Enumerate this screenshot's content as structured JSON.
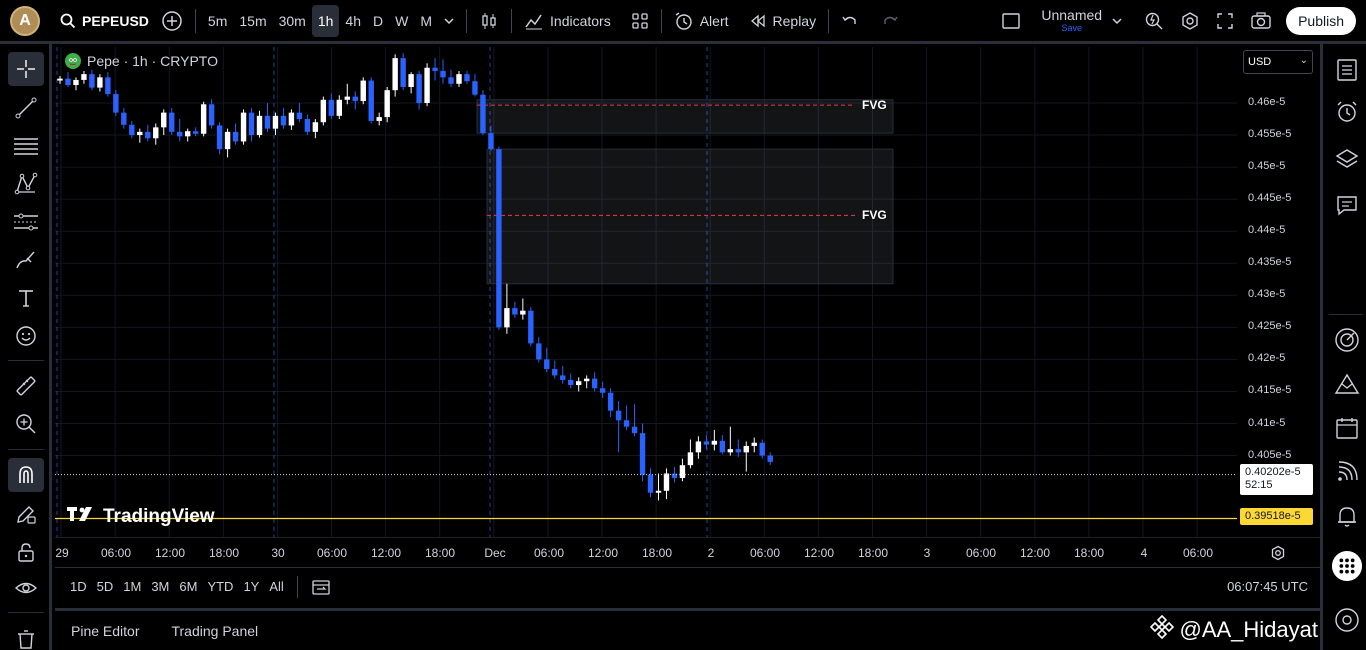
{
  "topbar": {
    "avatar_letter": "A",
    "symbol": "PEPEUSD",
    "timeframes": [
      "5m",
      "15m",
      "30m",
      "1h",
      "4h",
      "D",
      "W",
      "M"
    ],
    "active_timeframe": "1h",
    "indicators_label": "Indicators",
    "alert_label": "Alert",
    "replay_label": "Replay",
    "layout_name": "Unnamed",
    "layout_save": "Save",
    "publish_label": "Publish"
  },
  "legend": {
    "title": "Pepe · 1h · CRYPTO"
  },
  "fvg": [
    {
      "label": "FVG",
      "top": 0.4605,
      "bottom": 0.4553,
      "mid": 0.45967
    },
    {
      "label": "FVG",
      "top": 0.4528,
      "bottom": 0.4318,
      "mid": 0.44247
    }
  ],
  "watermark": "TradingView",
  "price_scale": {
    "currency": "USD",
    "ticks": [
      "0.46e-5",
      "0.455e-5",
      "0.45e-5",
      "0.445e-5",
      "0.44e-5",
      "0.435e-5",
      "0.43e-5",
      "0.425e-5",
      "0.42e-5",
      "0.415e-5",
      "0.41e-5",
      "0.405e-5"
    ],
    "last_price": "0.40202e-5",
    "countdown": "52:15",
    "yellow_price": "0.39518e-5"
  },
  "time_axis": [
    "29",
    "06:00",
    "12:00",
    "18:00",
    "30",
    "06:00",
    "12:00",
    "18:00",
    "Dec",
    "06:00",
    "12:00",
    "18:00",
    "2",
    "06:00",
    "12:00",
    "18:00",
    "3",
    "06:00",
    "12:00",
    "18:00",
    "4",
    "06:00"
  ],
  "range_bar": {
    "ranges": [
      "1D",
      "5D",
      "1M",
      "3M",
      "6M",
      "YTD",
      "1Y",
      "All"
    ],
    "clock": "06:07:45 UTC"
  },
  "bottom_tabs": [
    "Pine Editor",
    "Trading Panel"
  ],
  "handle": "@AA_Hidayat",
  "colors": {
    "up": "#ffffff",
    "down": "#2962ff",
    "fvg_line": "#f23645",
    "yellow": "#fdd835"
  },
  "chart_data": {
    "type": "candlestick",
    "symbol": "PEPEUSD",
    "interval": "1h",
    "price_unit": "e-5 USD",
    "ylim": [
      0.3957,
      0.4678
    ],
    "x_range": [
      "Nov 29 00:00",
      "Dec 4 06:00"
    ],
    "candles": [
      [
        0.4635,
        0.4642,
        0.463,
        0.4638
      ],
      [
        0.4638,
        0.4648,
        0.4625,
        0.4628
      ],
      [
        0.4628,
        0.464,
        0.462,
        0.4636
      ],
      [
        0.4636,
        0.465,
        0.463,
        0.4645
      ],
      [
        0.4645,
        0.4652,
        0.462,
        0.4624
      ],
      [
        0.4624,
        0.4645,
        0.4618,
        0.464
      ],
      [
        0.464,
        0.4648,
        0.461,
        0.4614
      ],
      [
        0.4614,
        0.462,
        0.458,
        0.4585
      ],
      [
        0.4585,
        0.4592,
        0.456,
        0.4566
      ],
      [
        0.4566,
        0.4572,
        0.4545,
        0.455
      ],
      [
        0.455,
        0.456,
        0.4538,
        0.4555
      ],
      [
        0.4555,
        0.4566,
        0.454,
        0.4545
      ],
      [
        0.4545,
        0.4568,
        0.4535,
        0.4562
      ],
      [
        0.4562,
        0.459,
        0.455,
        0.4585
      ],
      [
        0.4585,
        0.4592,
        0.455,
        0.4555
      ],
      [
        0.4555,
        0.4575,
        0.454,
        0.4548
      ],
      [
        0.4548,
        0.456,
        0.454,
        0.4556
      ],
      [
        0.4556,
        0.4562,
        0.4548,
        0.4552
      ],
      [
        0.4552,
        0.4602,
        0.4548,
        0.4598
      ],
      [
        0.4598,
        0.4606,
        0.456,
        0.4565
      ],
      [
        0.4565,
        0.457,
        0.452,
        0.4528
      ],
      [
        0.4528,
        0.456,
        0.4515,
        0.4555
      ],
      [
        0.4555,
        0.4568,
        0.4535,
        0.454
      ],
      [
        0.454,
        0.459,
        0.4535,
        0.4585
      ],
      [
        0.4585,
        0.4592,
        0.454,
        0.455
      ],
      [
        0.455,
        0.4588,
        0.4546,
        0.458
      ],
      [
        0.458,
        0.46,
        0.4555,
        0.456
      ],
      [
        0.456,
        0.4585,
        0.455,
        0.458
      ],
      [
        0.458,
        0.4592,
        0.456,
        0.4565
      ],
      [
        0.4565,
        0.459,
        0.4558,
        0.4585
      ],
      [
        0.4585,
        0.46,
        0.457,
        0.4575
      ],
      [
        0.4575,
        0.4582,
        0.455,
        0.4555
      ],
      [
        0.4555,
        0.4575,
        0.4545,
        0.457
      ],
      [
        0.457,
        0.461,
        0.4565,
        0.4605
      ],
      [
        0.4605,
        0.4615,
        0.4575,
        0.458
      ],
      [
        0.458,
        0.4612,
        0.4575,
        0.4605
      ],
      [
        0.4605,
        0.463,
        0.4598,
        0.461
      ],
      [
        0.461,
        0.4618,
        0.459,
        0.4603
      ],
      [
        0.4603,
        0.464,
        0.4598,
        0.4635
      ],
      [
        0.4635,
        0.464,
        0.4568,
        0.4572
      ],
      [
        0.4572,
        0.4585,
        0.4565,
        0.4578
      ],
      [
        0.4578,
        0.4625,
        0.457,
        0.462
      ],
      [
        0.462,
        0.4676,
        0.461,
        0.467
      ],
      [
        0.467,
        0.4678,
        0.462,
        0.4625
      ],
      [
        0.4625,
        0.4648,
        0.4615,
        0.4645
      ],
      [
        0.4645,
        0.465,
        0.459,
        0.46
      ],
      [
        0.46,
        0.4662,
        0.4595,
        0.4655
      ],
      [
        0.4655,
        0.467,
        0.4635,
        0.465
      ],
      [
        0.465,
        0.4668,
        0.463,
        0.464
      ],
      [
        0.464,
        0.4652,
        0.4625,
        0.463
      ],
      [
        0.463,
        0.465,
        0.4625,
        0.4645
      ],
      [
        0.4645,
        0.465,
        0.463,
        0.4634
      ],
      [
        0.4634,
        0.4645,
        0.461,
        0.4613
      ],
      [
        0.4613,
        0.462,
        0.455,
        0.4553
      ],
      [
        0.4553,
        0.4565,
        0.4525,
        0.4528
      ],
      [
        0.4528,
        0.4532,
        0.4246,
        0.425
      ],
      [
        0.425,
        0.4318,
        0.424,
        0.428
      ],
      [
        0.428,
        0.429,
        0.4265,
        0.427
      ],
      [
        0.427,
        0.4295,
        0.4262,
        0.4276
      ],
      [
        0.4276,
        0.4282,
        0.422,
        0.4225
      ],
      [
        0.4225,
        0.4235,
        0.4195,
        0.42
      ],
      [
        0.42,
        0.4218,
        0.418,
        0.4185
      ],
      [
        0.4185,
        0.4198,
        0.417,
        0.4175
      ],
      [
        0.4175,
        0.419,
        0.4162,
        0.4168
      ],
      [
        0.4168,
        0.4178,
        0.4155,
        0.416
      ],
      [
        0.416,
        0.4172,
        0.415,
        0.4166
      ],
      [
        0.4166,
        0.4175,
        0.4155,
        0.417
      ],
      [
        0.417,
        0.418,
        0.415,
        0.4155
      ],
      [
        0.4155,
        0.4165,
        0.414,
        0.4148
      ],
      [
        0.4148,
        0.4155,
        0.411,
        0.412
      ],
      [
        0.412,
        0.4135,
        0.4055,
        0.4105
      ],
      [
        0.4105,
        0.4128,
        0.409,
        0.4095
      ],
      [
        0.4095,
        0.413,
        0.408,
        0.4085
      ],
      [
        0.4085,
        0.41,
        0.401,
        0.402
      ],
      [
        0.402,
        0.403,
        0.3985,
        0.3992
      ],
      [
        0.3992,
        0.4022,
        0.398,
        0.3995
      ],
      [
        0.3995,
        0.403,
        0.3982,
        0.4022
      ],
      [
        0.4022,
        0.4032,
        0.4008,
        0.4015
      ],
      [
        0.4015,
        0.4045,
        0.401,
        0.4035
      ],
      [
        0.4035,
        0.4075,
        0.403,
        0.4055
      ],
      [
        0.4055,
        0.408,
        0.4045,
        0.4072
      ],
      [
        0.4072,
        0.4082,
        0.406,
        0.4067
      ],
      [
        0.4067,
        0.409,
        0.4058,
        0.4073
      ],
      [
        0.4073,
        0.4082,
        0.4052,
        0.4055
      ],
      [
        0.4055,
        0.4095,
        0.405,
        0.406
      ],
      [
        0.406,
        0.4075,
        0.4048,
        0.4055
      ],
      [
        0.4055,
        0.4072,
        0.4025,
        0.4065
      ],
      [
        0.4065,
        0.4078,
        0.4055,
        0.407
      ],
      [
        0.407,
        0.4075,
        0.4045,
        0.405
      ],
      [
        0.405,
        0.4055,
        0.4035,
        0.404
      ]
    ],
    "last_price": 0.40202,
    "marked_price": 0.39518
  }
}
